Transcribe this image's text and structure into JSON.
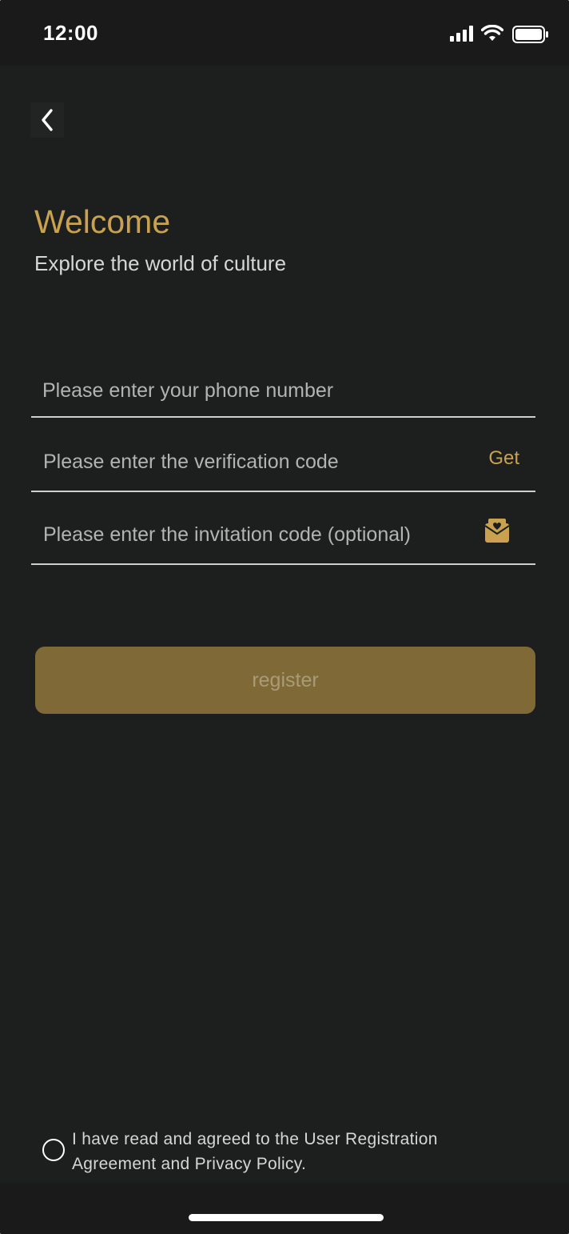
{
  "status_bar": {
    "time": "12:00",
    "icons": [
      "signal-icon",
      "wifi-icon",
      "battery-icon"
    ]
  },
  "nav": {
    "back_icon": "chevron-left-icon"
  },
  "header": {
    "title": "Welcome",
    "subtitle": "Explore the world of culture"
  },
  "form": {
    "phone_placeholder": "Please enter your phone number",
    "code_placeholder": "Please enter the verification code",
    "get_label": "Get",
    "invite_placeholder": "Please enter the invitation code (optional)",
    "invite_icon": "envelope-heart-icon",
    "register_label": "register"
  },
  "agreement": {
    "text": "I have read and agreed to the User Registration Agreement and Privacy Policy.",
    "checked": false
  },
  "colors": {
    "background": "#1d1e1e",
    "accent": "#c8a24e",
    "button": "#7f6a37"
  }
}
